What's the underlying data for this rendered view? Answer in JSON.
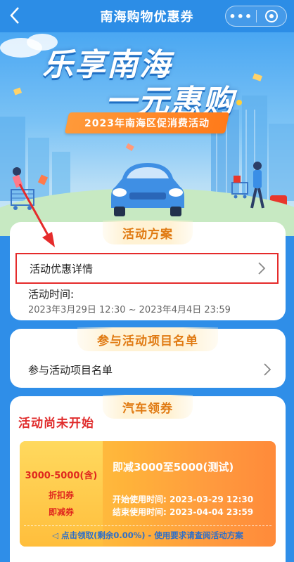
{
  "navbar": {
    "back_icon": "chevron-left-icon",
    "title": "南海购物优惠券",
    "more_label": "•••",
    "target_icon": "target-icon"
  },
  "banner": {
    "title_line1": "乐享南海",
    "title_line2": "一元惠购",
    "ribbon": "2023年南海区促消费活动"
  },
  "plan_card": {
    "tag": "活动方案",
    "detail_label": "活动优惠详情",
    "time_label": "活动时间:",
    "time_value": "2023年3月29日 12:30 ~ 2023年4月4日 23:59"
  },
  "project_card": {
    "tag": "参与活动项目名单",
    "row_label": "参与活动项目名单"
  },
  "coupon_card": {
    "tag": "汽车领券",
    "status": "活动尚未开始",
    "coupon": {
      "range": "3000-5000(含)",
      "type1": "折扣券",
      "type2": "即减券",
      "title": "即减3000至5000(测试)",
      "start": "开始使用时间:  2023-03-29 12:30",
      "end": "结束使用时间:  2023-04-04 23:59",
      "footer": "◁ 点击领取(剩余0.00%) - 使用要求请查阅活动方案"
    }
  },
  "colors": {
    "primary_blue": "#2c8de6",
    "tag_orange": "#e07a12",
    "alert_red": "#e02b2b",
    "coupon_orange": "#ff9a3e"
  }
}
